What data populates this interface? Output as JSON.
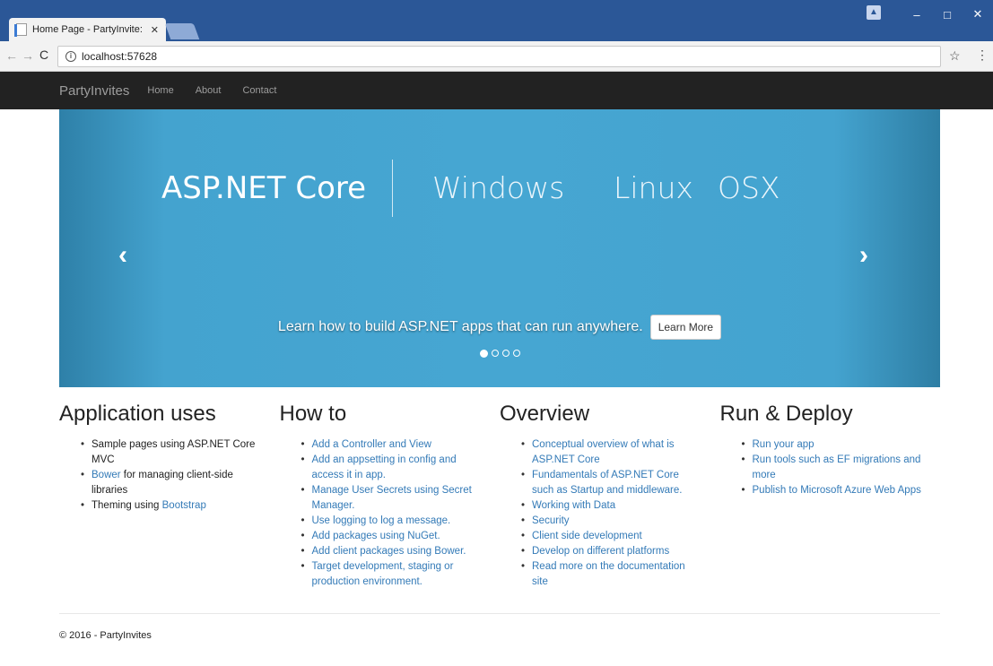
{
  "browser": {
    "tab_title": "Home Page - PartyInvite:",
    "tab_close": "✕",
    "url": "localhost:57628",
    "back": "←",
    "forward": "→",
    "reload": "C",
    "info": "i",
    "star": "☆",
    "menu": "⋮",
    "window_minimize": "–",
    "window_maximize": "□",
    "window_close": "✕",
    "profile": "▲"
  },
  "navbar": {
    "brand": "PartyInvites",
    "links": [
      "Home",
      "About",
      "Contact"
    ]
  },
  "carousel": {
    "platforms": [
      "ASP.NET Core",
      "Windows",
      "Linux",
      "OSX"
    ],
    "prev": "‹",
    "next": "›",
    "caption": "Learn how to build ASP.NET apps that can run anywhere.",
    "button": "Learn More",
    "active_slide": 1,
    "slide_count": 4
  },
  "columns": [
    {
      "heading": "Application uses",
      "items": [
        {
          "parts": [
            {
              "text": "Sample pages using ASP.NET Core MVC",
              "link": false
            }
          ]
        },
        {
          "parts": [
            {
              "text": "Bower",
              "link": true
            },
            {
              "text": " for managing client-side libraries",
              "link": false
            }
          ]
        },
        {
          "parts": [
            {
              "text": "Theming using ",
              "link": false
            },
            {
              "text": "Bootstrap",
              "link": true
            }
          ]
        }
      ]
    },
    {
      "heading": "How to",
      "items": [
        {
          "parts": [
            {
              "text": "Add a Controller and View",
              "link": true
            }
          ]
        },
        {
          "parts": [
            {
              "text": "Add an appsetting in config and access it in app.",
              "link": true
            }
          ]
        },
        {
          "parts": [
            {
              "text": "Manage User Secrets using Secret Manager.",
              "link": true
            }
          ]
        },
        {
          "parts": [
            {
              "text": "Use logging to log a message.",
              "link": true
            }
          ]
        },
        {
          "parts": [
            {
              "text": "Add packages using NuGet.",
              "link": true
            }
          ]
        },
        {
          "parts": [
            {
              "text": "Add client packages using Bower.",
              "link": true
            }
          ]
        },
        {
          "parts": [
            {
              "text": "Target development, staging or production environment.",
              "link": true
            }
          ]
        }
      ]
    },
    {
      "heading": "Overview",
      "items": [
        {
          "parts": [
            {
              "text": "Conceptual overview of what is ASP.NET Core",
              "link": true
            }
          ]
        },
        {
          "parts": [
            {
              "text": "Fundamentals of ASP.NET Core such as Startup and middleware.",
              "link": true
            }
          ]
        },
        {
          "parts": [
            {
              "text": "Working with Data",
              "link": true
            }
          ]
        },
        {
          "parts": [
            {
              "text": "Security",
              "link": true
            }
          ]
        },
        {
          "parts": [
            {
              "text": "Client side development",
              "link": true
            }
          ]
        },
        {
          "parts": [
            {
              "text": "Develop on different platforms",
              "link": true
            }
          ]
        },
        {
          "parts": [
            {
              "text": "Read more on the documentation site",
              "link": true
            }
          ]
        }
      ]
    },
    {
      "heading": "Run & Deploy",
      "items": [
        {
          "parts": [
            {
              "text": "Run your app",
              "link": true
            }
          ]
        },
        {
          "parts": [
            {
              "text": "Run tools such as EF migrations and more",
              "link": true
            }
          ]
        },
        {
          "parts": [
            {
              "text": "Publish to Microsoft Azure Web Apps",
              "link": true
            }
          ]
        }
      ]
    }
  ],
  "footer": "© 2016 - PartyInvites"
}
